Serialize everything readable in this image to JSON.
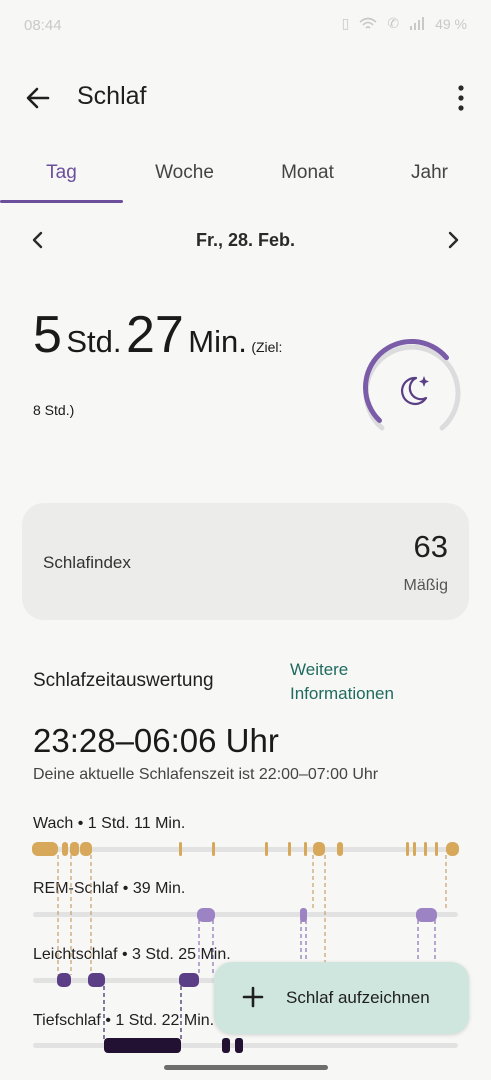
{
  "status_bar": {
    "time": "08:44",
    "battery": "49 %"
  },
  "app_bar": {
    "title": "Schlaf"
  },
  "tabs": [
    {
      "label": "Tag",
      "active": true
    },
    {
      "label": "Woche",
      "active": false
    },
    {
      "label": "Monat",
      "active": false
    },
    {
      "label": "Jahr",
      "active": false
    }
  ],
  "date_nav": {
    "date": "Fr., 28. Feb."
  },
  "duration": {
    "hours": "5",
    "hours_unit": "Std.",
    "minutes": "27",
    "minutes_unit": "Min.",
    "goal_prefix": "(Ziel:",
    "goal_suffix": "8 Std.)",
    "goal_progress": 0.68
  },
  "score_card": {
    "label": "Schlafindex",
    "score": "63",
    "rating": "Mäßig"
  },
  "analysis": {
    "title": "Schlafzeitauswertung",
    "more_link": "Weitere Informationen",
    "range": "23:28–06:06 Uhr",
    "usual": "Deine aktuelle Schlafenszeit ist 22:00–07:00 Uhr"
  },
  "stages": [
    {
      "label": "Wach • 1 Std. 11 Min.",
      "color": "#d7a75a"
    },
    {
      "label": "REM-Schlaf • 39 Min.",
      "color": "#9c84c4"
    },
    {
      "label": "Leichtschlaf • 3 Std. 25 Min.",
      "color": "#5a3f86"
    },
    {
      "label": "Tiefschlaf • 1 Std. 22 Min.",
      "color": "#231133"
    }
  ],
  "fab": {
    "label": "Schlaf aufzeichnen"
  },
  "colors": {
    "accent": "#6b4f9c",
    "link": "#1f6b5f",
    "fab_bg": "#cfe6df"
  }
}
